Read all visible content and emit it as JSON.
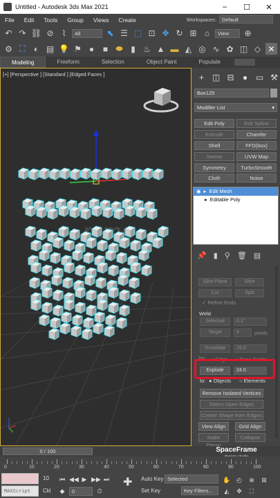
{
  "window": {
    "title": "Untitled - Autodesk 3ds Max 2021",
    "minimize": "–",
    "maximize": "☐",
    "close": "✕"
  },
  "menu": {
    "items": [
      "File",
      "Edit",
      "Tools",
      "Group",
      "Views",
      "Create"
    ],
    "workspaces_label": "Workspaces:",
    "workspace_value": "Default"
  },
  "toolbar": {
    "filter_value": "All",
    "view_value": "View"
  },
  "ribbon": {
    "tabs": [
      "Modeling",
      "Freeform",
      "Selection",
      "Object Paint",
      "Populate"
    ]
  },
  "viewport": {
    "label": "[+] [Perspective ] [Standard ] [Edged Faces ]"
  },
  "command_panel": {
    "object_name": "Box125",
    "modifier_list": "Modifier List",
    "modifier_buttons": [
      [
        "Edit Poly",
        "Edit Spline"
      ],
      [
        "Extrude",
        "Chamfer"
      ],
      [
        "Shell",
        "FFD(box)"
      ],
      [
        "Sweep",
        "UVW Map"
      ],
      [
        "Symmetry",
        "TurboSmooth"
      ],
      [
        "Cloth",
        "Noise"
      ]
    ],
    "stack": [
      "Edit Mesh",
      "Editable Poly"
    ],
    "slice_plane": "Slice Plane",
    "slice": "Slice",
    "cut": "Cut",
    "split": "Split",
    "refine_ends": "Refine Ends",
    "weld_title": "Weld",
    "weld_selected": "Selected",
    "weld_selected_value": "0.1\"",
    "weld_target": "Target",
    "weld_target_value": "4",
    "pixels": "pixels",
    "tessellate": "Tessellate",
    "tessellate_value": "25.0",
    "by": "by:",
    "edge": "Edge",
    "face_center": "Face-Cente",
    "explode": "Explode",
    "explode_value": "24.0",
    "to": "to:",
    "objects": "Objects",
    "elements": "Elements",
    "remove_isolated": "Remove Isolated Vertices",
    "select_open_edges": "Select Open Edges",
    "create_shape": "Create Shape from Edges",
    "view_align": "View Align",
    "grid_align": "Grid Align",
    "make_planar": "Make Planar",
    "collapse": "Collapse"
  },
  "timeline": {
    "slider": "0 / 100",
    "ticks": [
      "0",
      "10",
      "20",
      "30",
      "40",
      "50",
      "60",
      "70",
      "80",
      "90",
      "100"
    ]
  },
  "bottom": {
    "maxscript": "MAXScript",
    "frame_label": "10",
    "ckl_label": "Ckl",
    "auto_key": "Auto Key",
    "set_key": "Set Key",
    "selected": "Selected",
    "key_filters": "Key Filters...",
    "frame_value": "0"
  },
  "watermark": {
    "title": "SpaceFrame",
    "subtitle": "design studio"
  },
  "colors": {
    "viewport_border": "#d3b03c",
    "highlight_red": "#e0152b",
    "selection_cyan": "#4de2f0",
    "stack_selected": "#4f8fd6"
  }
}
